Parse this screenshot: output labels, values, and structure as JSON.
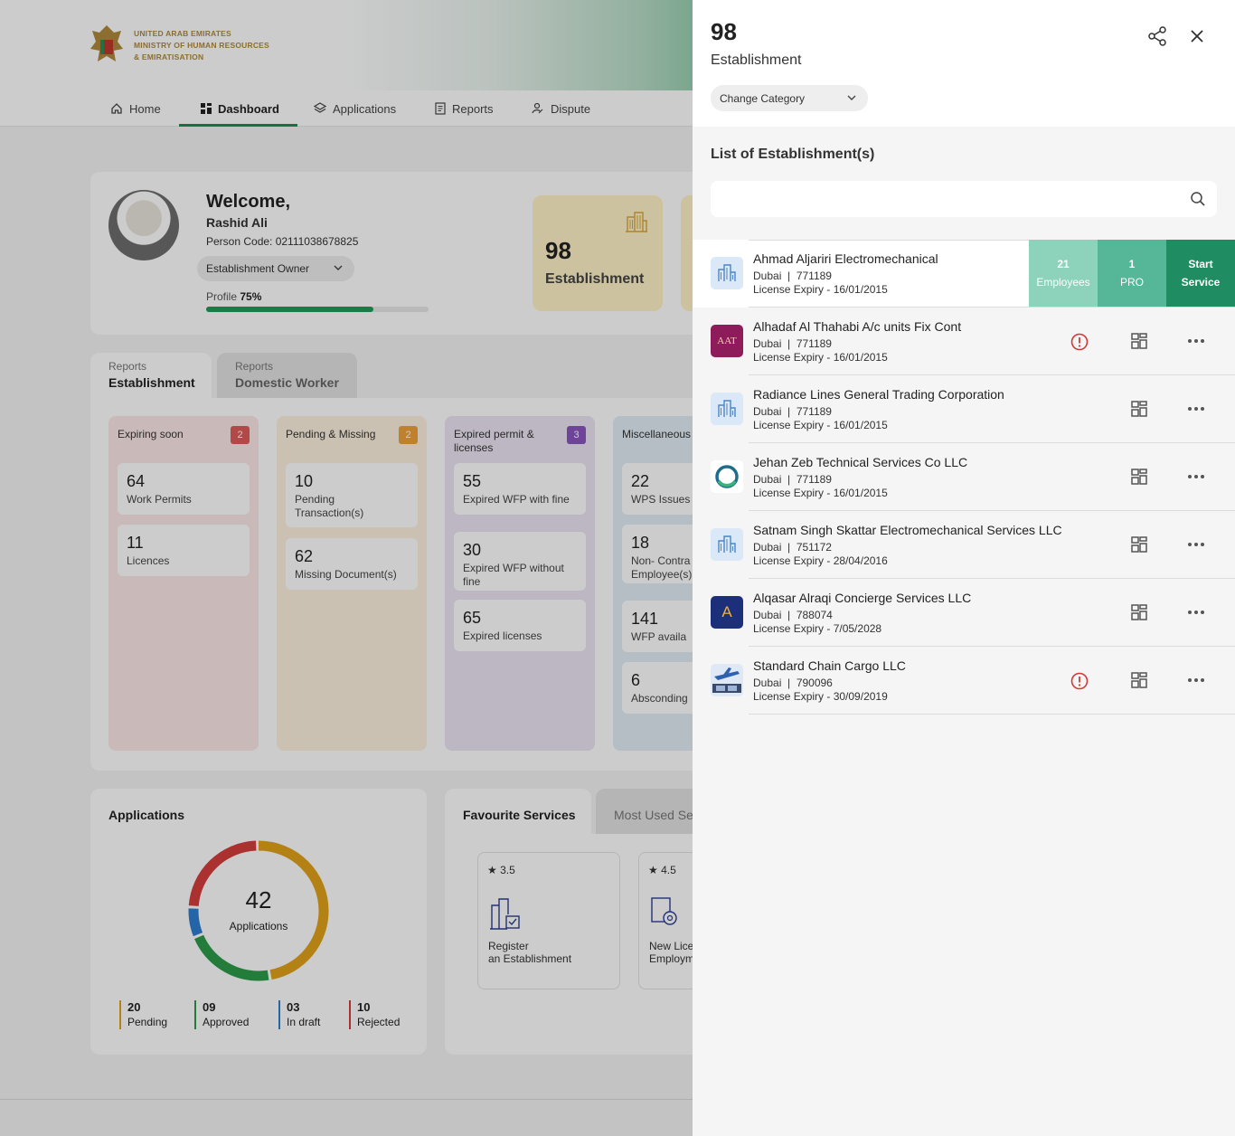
{
  "header": {
    "org_line1": "UNITED ARAB EMIRATES",
    "org_line2": "MINISTRY OF HUMAN RESOURCES",
    "org_line3": "& EMIRATISATION"
  },
  "nav": {
    "items": [
      {
        "label": "Home",
        "icon": "home-icon"
      },
      {
        "label": "Dashboard",
        "icon": "dashboard-icon",
        "active": true
      },
      {
        "label": "Applications",
        "icon": "layers-icon"
      },
      {
        "label": "Reports",
        "icon": "document-icon"
      },
      {
        "label": "Dispute",
        "icon": "dispute-icon"
      }
    ]
  },
  "profile": {
    "welcome": "Welcome,",
    "name": "Rashid Ali",
    "person_code": "Person Code: 02111038678825",
    "role": "Establishment Owner",
    "profile_label": "Profile",
    "profile_percent": "75%",
    "profile_value": 0.75
  },
  "establishment_tile": {
    "count": "98",
    "label": "Establishment"
  },
  "report_tabs": [
    {
      "small": "Reports",
      "big": "Establishment"
    },
    {
      "small": "Reports",
      "big": "Domestic Worker"
    }
  ],
  "columns": [
    {
      "title": "Expiring soon",
      "badge": "2",
      "color": "#e05a5a",
      "stats": [
        {
          "value": "64",
          "desc": "Work Permits"
        },
        {
          "value": "11",
          "desc": "Licences"
        }
      ]
    },
    {
      "title": "Pending & Missing",
      "badge": "2",
      "color": "#f0a23a",
      "stats": [
        {
          "value": "10",
          "desc": "Pending Transaction(s)"
        },
        {
          "value": "62",
          "desc": "Missing Document(s)"
        }
      ]
    },
    {
      "title": "Expired permit & licenses",
      "badge": "3",
      "color": "#8a56c2",
      "stats": [
        {
          "value": "55",
          "desc": "Expired WFP with fine"
        },
        {
          "value": "30",
          "desc": "Expired WFP without fine"
        },
        {
          "value": "65",
          "desc": "Expired licenses"
        }
      ]
    },
    {
      "title": "Miscellaneous",
      "badge": "",
      "color": "#3a8fc2",
      "stats": [
        {
          "value": "22",
          "desc": "WPS Issues"
        },
        {
          "value": "18",
          "desc": "Non- Contra Employee(s)"
        },
        {
          "value": "141",
          "desc": "WFP availa"
        },
        {
          "value": "6",
          "desc": "Absconding"
        }
      ]
    }
  ],
  "applications": {
    "title": "Applications",
    "total": "42",
    "total_label": "Applications",
    "legend": [
      {
        "value": "20",
        "label": "Pending",
        "color": "#e2a21b",
        "count": 20
      },
      {
        "value": "09",
        "label": "Approved",
        "color": "#2e9b4a",
        "count": 9
      },
      {
        "value": "03",
        "label": "In draft",
        "color": "#2c7fd1",
        "count": 3
      },
      {
        "value": "10",
        "label": "Rejected",
        "color": "#d63d3d",
        "count": 10
      }
    ]
  },
  "services": {
    "tab_active": "Favourite Services",
    "tab_inactive": "Most Used Se",
    "cards": [
      {
        "rating": "3.5",
        "name_line1": "Register",
        "name_line2": "an Establishment"
      },
      {
        "rating": "4.5",
        "name_line1": "New Lice",
        "name_line2": "Employm"
      }
    ]
  },
  "panel": {
    "count": "98",
    "label": "Establishment",
    "category": "Change Category",
    "list_title": "List of Establishment(s)",
    "search_placeholder": "",
    "actions": {
      "employees_value": "21",
      "employees_label": "Employees",
      "pro_value": "1",
      "pro_label": "PRO",
      "start_line1": "Start",
      "start_line2": "Service"
    },
    "rows": [
      {
        "name": "Ahmad Aljariri Electromechanical",
        "city": "Dubai",
        "code": "771189",
        "expiry": "License Expiry - 16/01/2015",
        "logo": "building-icon",
        "warning": false
      },
      {
        "name": "Alhadaf Al Thahabi A/c units Fix Cont",
        "city": "Dubai",
        "code": "771189",
        "expiry": "License Expiry - 16/01/2015",
        "logo": "aat-logo",
        "logo_text": "AAT",
        "warning": true
      },
      {
        "name": "Radiance Lines General Trading Corporation",
        "city": "Dubai",
        "code": "771189",
        "expiry": "License Expiry - 16/01/2015",
        "logo": "building-icon",
        "warning": false
      },
      {
        "name": "Jehan Zeb Technical Services Co LLC",
        "city": "Dubai",
        "code": "771189",
        "expiry": "License Expiry - 16/01/2015",
        "logo": "ring-logo",
        "warning": false
      },
      {
        "name": "Satnam Singh Skattar Electromechanical Services LLC",
        "city": "Dubai",
        "code": "751172",
        "expiry": "License Expiry - 28/04/2016",
        "logo": "building-icon",
        "warning": false
      },
      {
        "name": "Alqasar Alraqi Concierge Services LLC",
        "city": "Dubai",
        "code": "788074",
        "expiry": "License Expiry - 7/05/2028",
        "logo": "a-logo",
        "logo_text": "A",
        "warning": false
      },
      {
        "name": "Standard Chain Cargo LLC",
        "city": "Dubai",
        "code": "790096",
        "expiry": "License Expiry - 30/09/2019",
        "logo": "cargo-logo",
        "warning": true
      }
    ]
  }
}
